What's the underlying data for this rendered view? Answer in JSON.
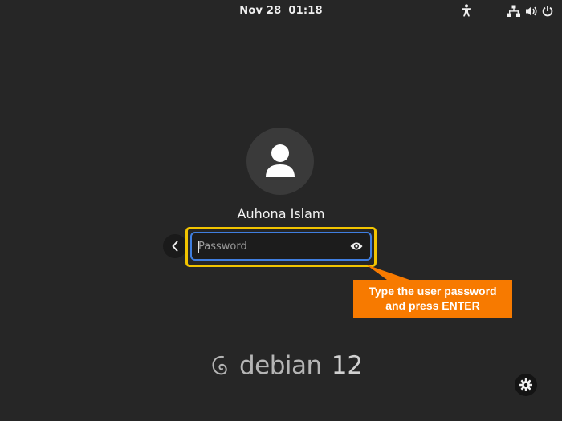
{
  "top_bar": {
    "date": "Nov 28",
    "time": "01:18"
  },
  "status_icons": [
    "accessibility-icon",
    "network-wired-icon",
    "volume-icon",
    "power-icon"
  ],
  "login": {
    "user_name": "Auhona Islam",
    "password_placeholder": "Password",
    "password_value": ""
  },
  "annotation": {
    "line1": "Type the user password",
    "line2": "and press ENTER",
    "box_color": "#f77a00",
    "highlight_color": "#f2c400"
  },
  "branding": {
    "wordmark": "debian",
    "version": "12"
  },
  "colors": {
    "background": "#262626",
    "input_focus": "#3f7ee0"
  }
}
